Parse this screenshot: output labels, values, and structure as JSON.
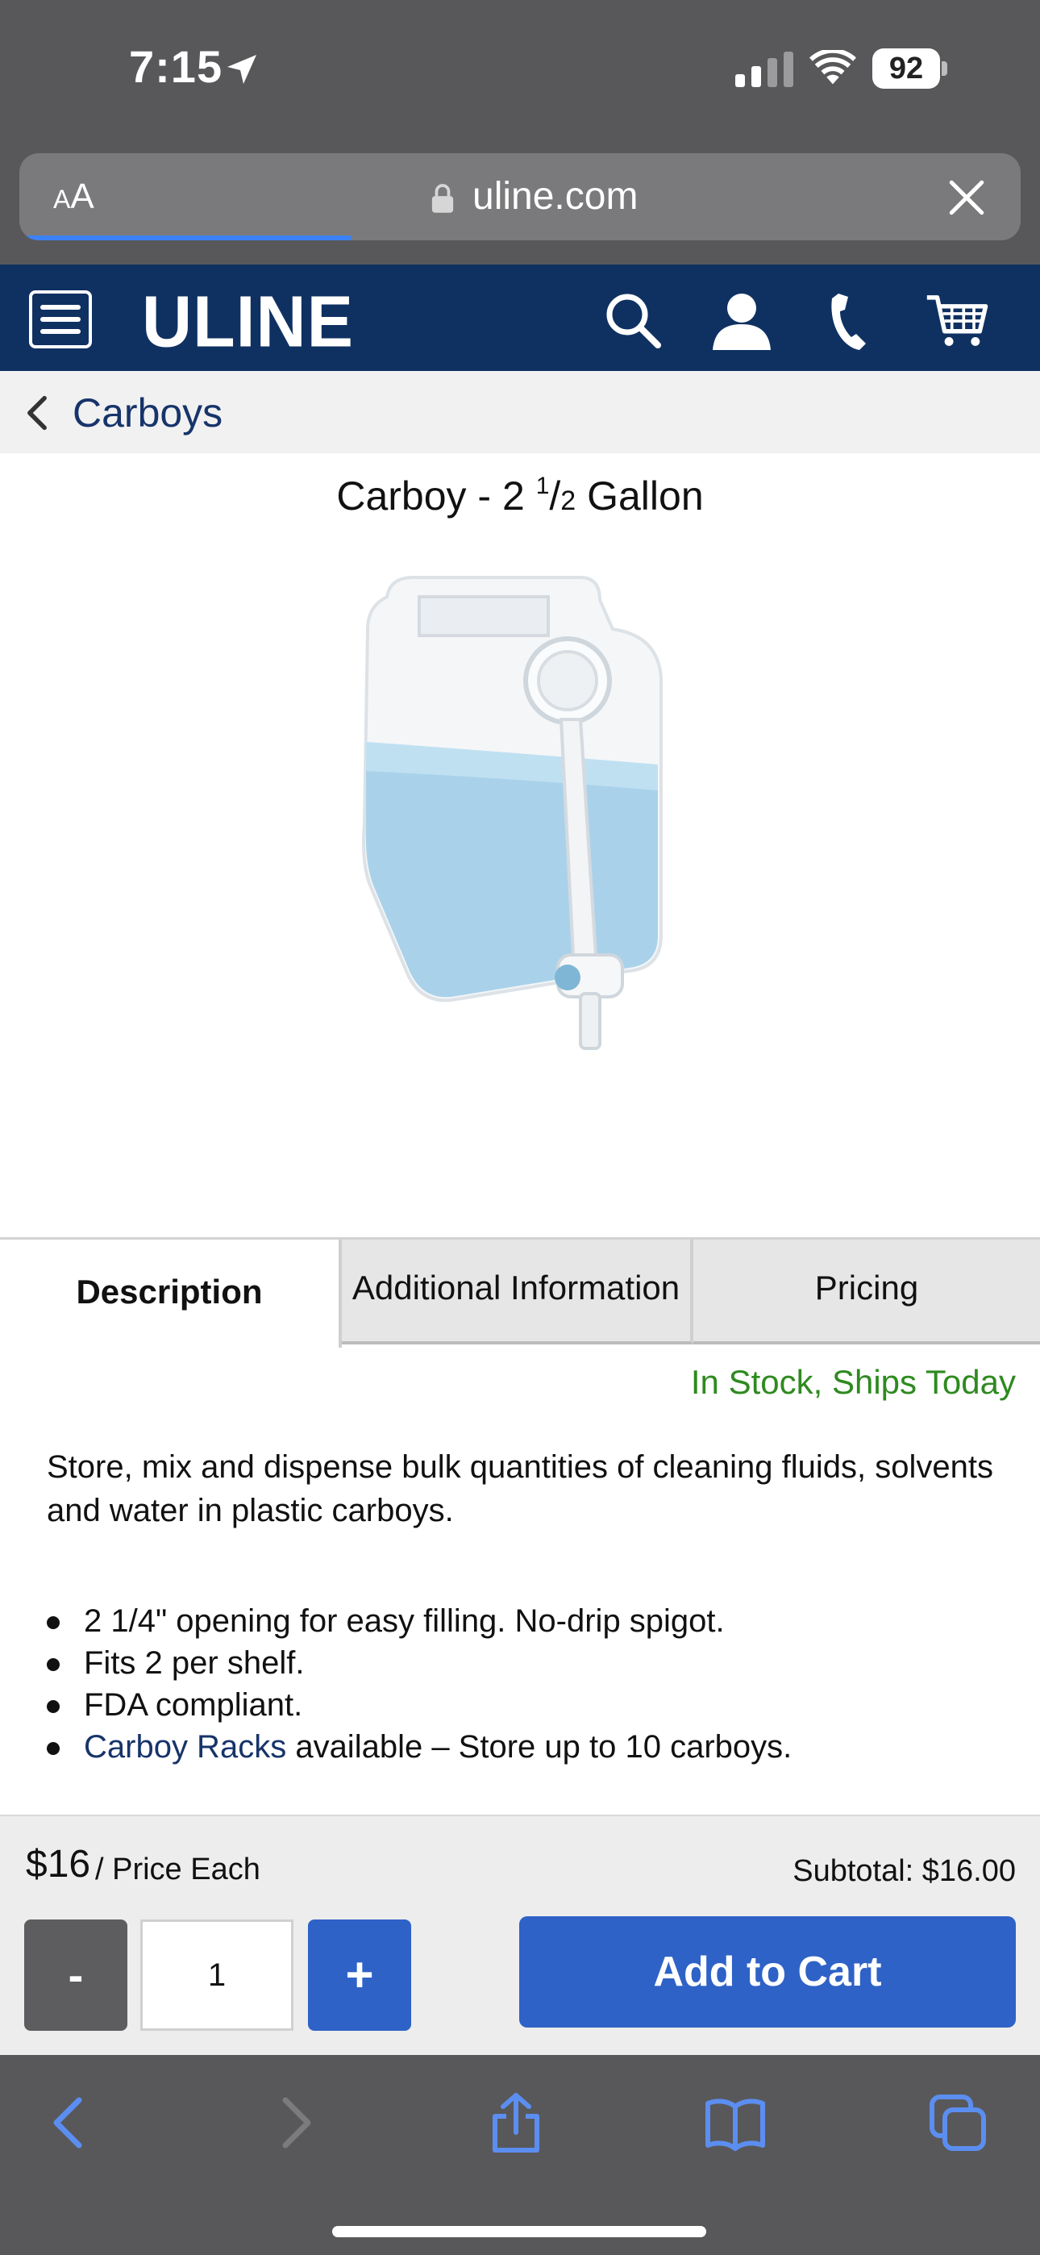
{
  "status_bar": {
    "time": "7:15",
    "battery": "92"
  },
  "browser": {
    "aa_label_small": "A",
    "aa_label_large": "A",
    "url": "uline.com",
    "load_progress": 0.33
  },
  "site": {
    "logo": "ULINE",
    "brand_color": "#0f3162"
  },
  "breadcrumb": {
    "label": "Carboys"
  },
  "product": {
    "title_prefix": "Carboy - 2 ",
    "title_fraction_num": "1",
    "title_fraction_den": "2",
    "title_suffix": " Gallon"
  },
  "tabs": [
    {
      "label": "Description",
      "active": true
    },
    {
      "label": "Additional Information",
      "active": false
    },
    {
      "label": "Pricing",
      "active": false
    }
  ],
  "description": {
    "stock_status": "In Stock, Ships Today",
    "intro": "Store, mix and dispense bulk quantities of cleaning fluids, solvents and water in plastic carboys.",
    "bullets": [
      "2 1/4\" opening for easy filling. No-drip spigot.",
      "Fits 2 per shelf.",
      "FDA compliant."
    ],
    "bullet_link": "Carboy Racks",
    "bullet_link_suffix": " available – Store up to 10 carboys."
  },
  "purchase": {
    "price": "$16",
    "price_unit": "/ Price Each",
    "subtotal": "Subtotal: $16.00",
    "minus_label": "-",
    "quantity": "1",
    "plus_label": "+",
    "add_to_cart": "Add to Cart",
    "accent_color": "#2e62c6"
  }
}
